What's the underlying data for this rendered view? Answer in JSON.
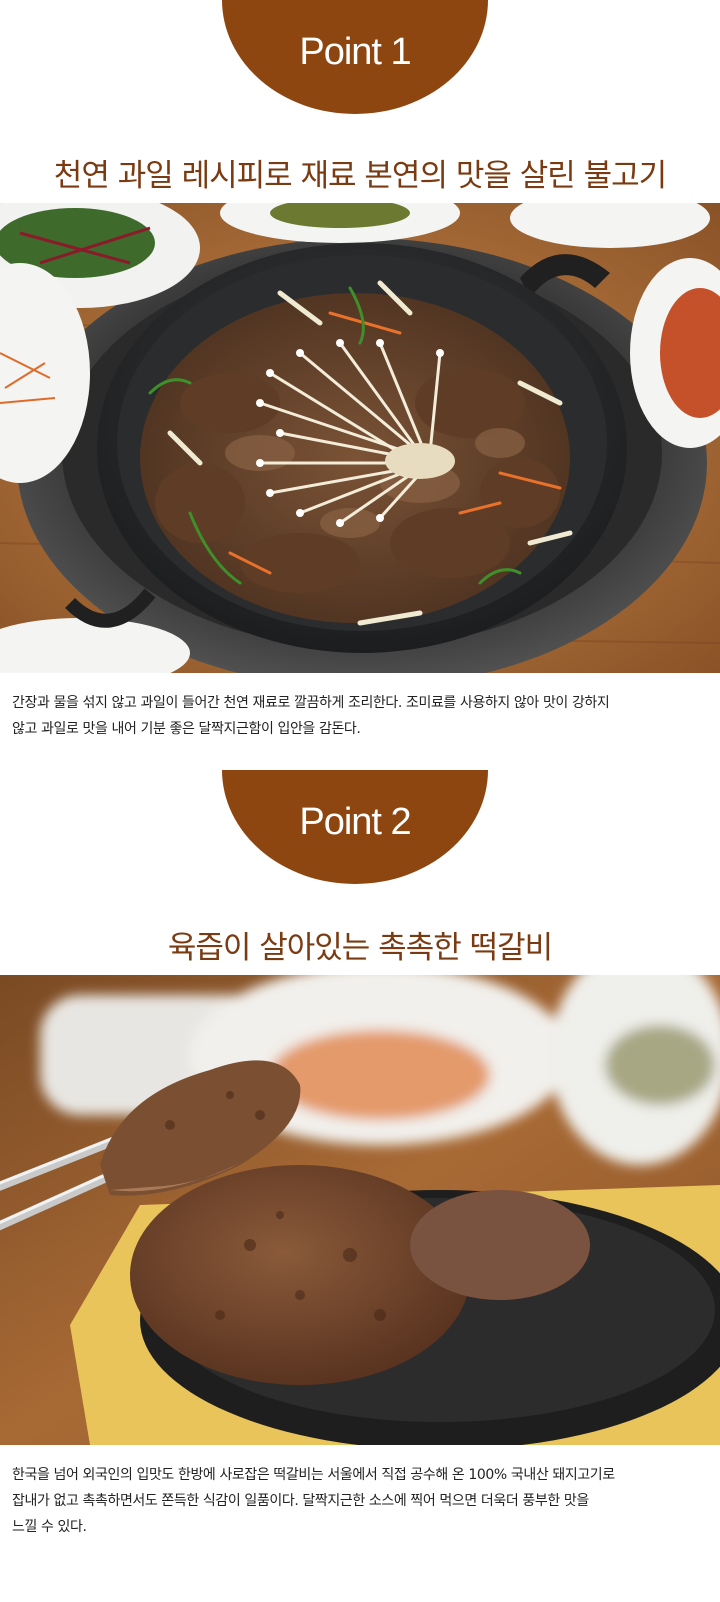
{
  "point1": {
    "badge": "Point 1",
    "headline": "천연 과일 레시피로 재료 본연의 맛을 살린 불고기",
    "photo_icon": "bulgogi-pan-photo",
    "desc_line1": "간장과 물을 섞지 않고 과일이 들어간 천연 재료로 깔끔하게 조리한다. 조미료를 사용하지 않아 맛이 강하지",
    "desc_line2": "않고 과일로 맛을 내어 기분 좋은 달짝지근함이 입안을 감돈다."
  },
  "point2": {
    "badge": "Point 2",
    "headline": "육즙이 살아있는 촉촉한 떡갈비",
    "photo_icon": "tteokgalbi-plate-photo",
    "desc_line1": "한국을 넘어 외국인의 입맛도 한방에 사로잡은 떡갈비는 서울에서 직접 공수해 온 100% 국내산 돼지고기로",
    "desc_line2": "잡내가 없고 촉촉하면서도 쫀득한 식감이 일품이다. 달짝지근한 소스에 찍어 먹으면 더욱더 풍부한 맛을",
    "desc_line3": "느낄 수 있다."
  },
  "colors": {
    "badge": "#8e4611",
    "headline": "#7a3b12"
  }
}
